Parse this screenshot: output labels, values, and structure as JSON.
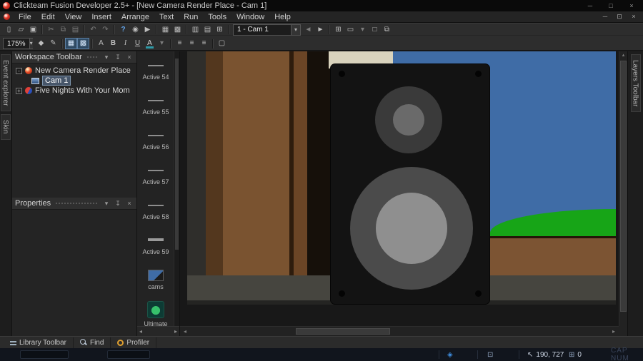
{
  "window": {
    "title": "Clickteam Fusion Developer 2.5+ - [New Camera Render Place - Cam 1]",
    "minimize": "─",
    "maximize": "□",
    "close": "×"
  },
  "menu": {
    "items": [
      "File",
      "Edit",
      "View",
      "Insert",
      "Arrange",
      "Text",
      "Run",
      "Tools",
      "Window",
      "Help"
    ],
    "mdi": {
      "minimize": "─",
      "restore": "⊡",
      "close": "×"
    }
  },
  "toolbar_main": {
    "icons": [
      {
        "n": "new-file",
        "g": "▯"
      },
      {
        "n": "open-folder",
        "g": "▱"
      },
      {
        "n": "save",
        "g": "▣"
      },
      {
        "n": "cut",
        "g": "✂"
      },
      {
        "n": "copy",
        "g": "⧉"
      },
      {
        "n": "paste",
        "g": "▤"
      },
      {
        "n": "undo",
        "g": "↶"
      },
      {
        "n": "redo",
        "g": "↷"
      },
      {
        "n": "help",
        "g": "?"
      },
      {
        "n": "run-application",
        "g": "◉"
      },
      {
        "n": "run-frame",
        "g": "▶"
      },
      {
        "n": "storyboard-editor",
        "g": "▦"
      },
      {
        "n": "frame-editor",
        "g": "▩"
      },
      {
        "n": "event-editor",
        "g": "▥"
      },
      {
        "n": "event-list-editor",
        "g": "▤"
      },
      {
        "n": "data-elements",
        "g": "⊞"
      }
    ],
    "frame_selector": "1 - Cam 1",
    "combo_arrow": "▾",
    "prev": "◄",
    "next": "►",
    "icons_right": [
      {
        "n": "grid-options",
        "g": "⊞"
      },
      {
        "n": "zoom-select",
        "g": "▭"
      },
      {
        "n": "zoom-menu",
        "g": "▾"
      },
      {
        "n": "frame-area",
        "g": "□"
      },
      {
        "n": "screen-clones",
        "g": "⧉"
      }
    ]
  },
  "toolbar_format": {
    "zoom": "175%",
    "combo_arrow": "▾",
    "icons": [
      {
        "n": "object-tool",
        "g": "◆"
      },
      {
        "n": "draw-tool",
        "g": "✎"
      },
      {
        "n": "grid-show",
        "g": "▦"
      },
      {
        "n": "grid-snap",
        "g": "▩"
      },
      {
        "n": "font",
        "g": "A"
      },
      {
        "n": "bold",
        "g": "B"
      },
      {
        "n": "italic",
        "g": "I"
      },
      {
        "n": "underline",
        "g": "U"
      },
      {
        "n": "font-color",
        "g": "A"
      },
      {
        "n": "font-color-menu",
        "g": "▾"
      },
      {
        "n": "align-left",
        "g": "≡"
      },
      {
        "n": "align-center",
        "g": "≡"
      },
      {
        "n": "align-right",
        "g": "≡"
      },
      {
        "n": "transparent-mode",
        "g": "▢"
      }
    ]
  },
  "side_tabs": {
    "left": [
      "Event explorer",
      "Skin"
    ],
    "right": [
      "Layers Toolbar"
    ]
  },
  "workspace_panel": {
    "title": "Workspace Toolbar",
    "menu_glyph": "▾",
    "pin_glyph": "↧",
    "close_glyph": "×",
    "tree": [
      {
        "expander": "-",
        "label": "New Camera Render Place"
      },
      {
        "label": "Cam 1"
      },
      {
        "expander": "+",
        "label": "Five Nights With Your Mom"
      }
    ]
  },
  "properties_panel": {
    "title": "Properties",
    "menu_glyph": "▾",
    "pin_glyph": "↧",
    "close_glyph": "×"
  },
  "objects_panel": {
    "items": [
      {
        "label": "Active 54"
      },
      {
        "label": "Active 55"
      },
      {
        "label": "Active 56"
      },
      {
        "label": "Active 57"
      },
      {
        "label": "Active 58"
      },
      {
        "label": "Active 59"
      },
      {
        "label": "cams"
      },
      {
        "label": "Ultimate Fullscreen"
      }
    ]
  },
  "bottom_tabs": {
    "items": [
      {
        "label": "Library Toolbar",
        "icon": "library-grid"
      },
      {
        "label": "Find",
        "icon": "magnifier"
      },
      {
        "label": "Profiler",
        "icon": "clock"
      }
    ]
  },
  "status_bar": {
    "pointer_glyph": "↖",
    "coordinates": "190, 727",
    "count_glyph": "⊞",
    "object_count": "0",
    "keys": "CAP NUM",
    "accent_color": "#3f8fe0"
  },
  "scene": {
    "wall_edge": "#2f2e2b",
    "wood_dark": "#53371e",
    "wood_panel": "#7a5330",
    "wood_seam": "#2e1c0d",
    "wood_panel2": "#6b4526",
    "dark_column": "#16100a",
    "pillar_beige": "#d9d3bd",
    "sky_blue": "#3f6ca6",
    "grass_green": "#17a517",
    "sill_brown": "#7c5433",
    "floor_gray": "#46453f",
    "speaker_black": "#131313",
    "tweeter_outer": "#3a3a3a",
    "tweeter_inner": "#6a6a6a",
    "woofer_outer": "#4b4b4b",
    "woofer_inner": "#8f8f8f"
  }
}
